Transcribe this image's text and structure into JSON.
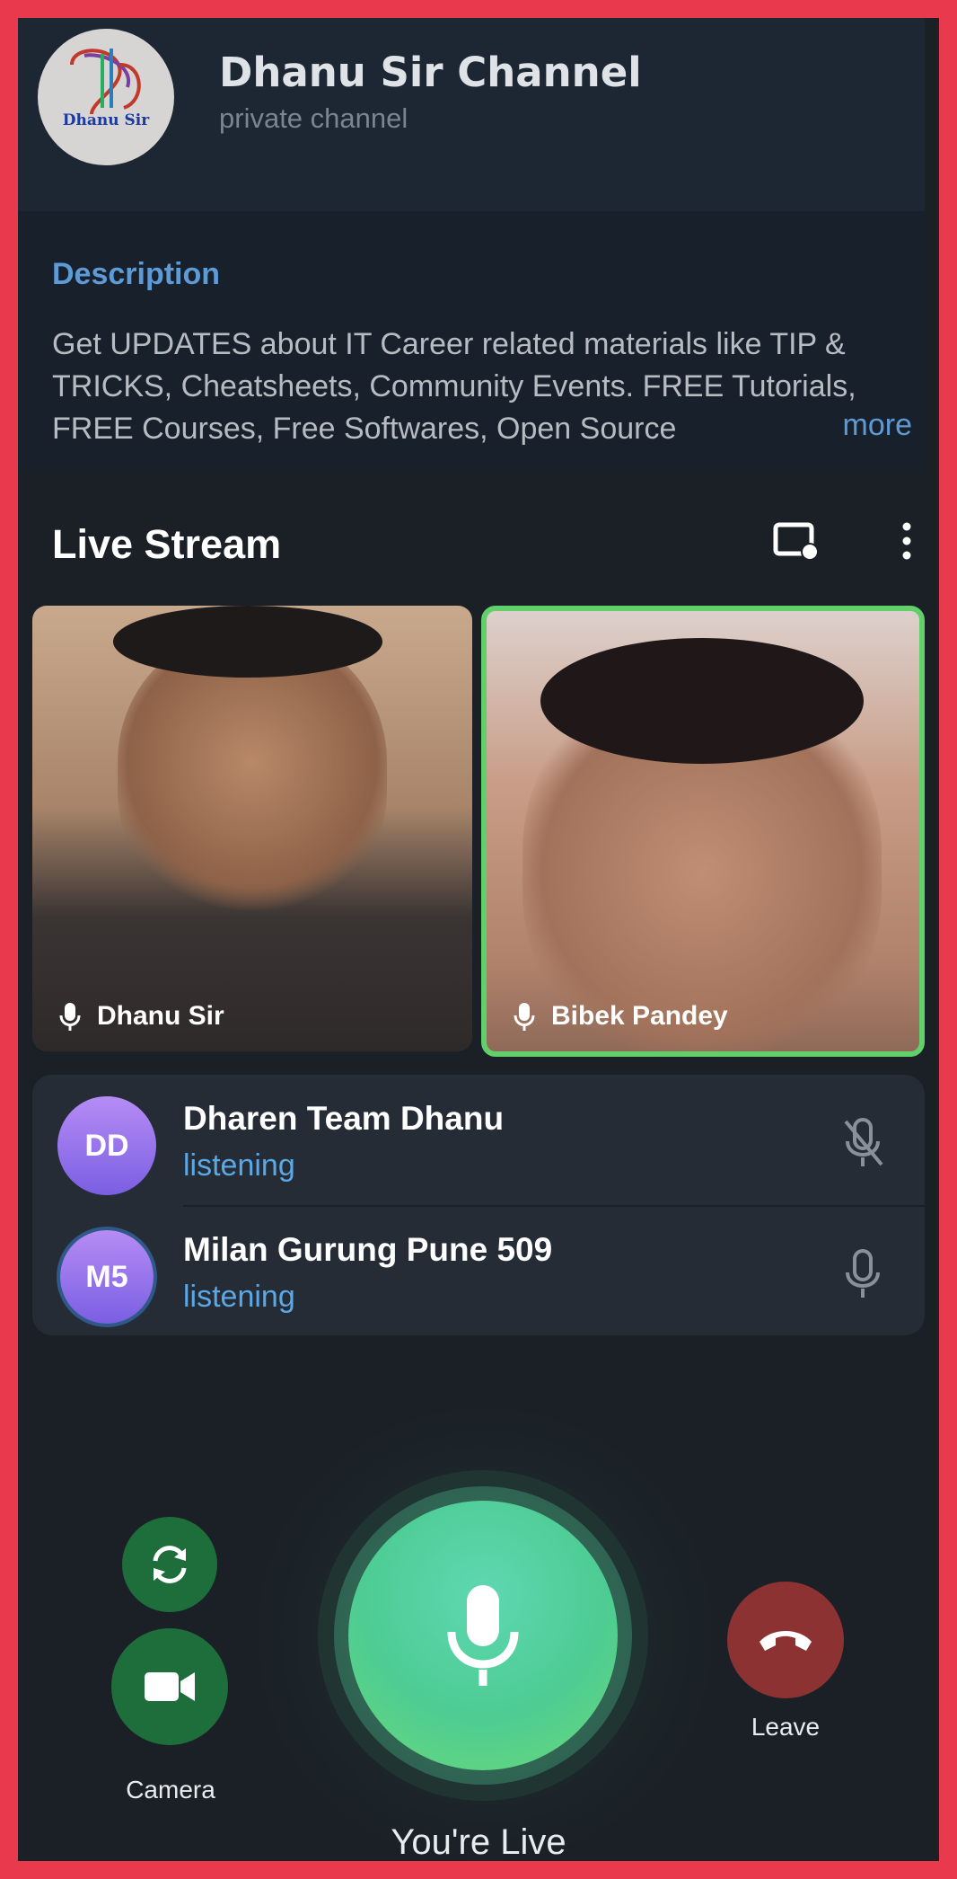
{
  "channel": {
    "title": "Dhanu Sir Channel",
    "subtitle": "private channel",
    "logo_text": "Dhanu Sir"
  },
  "description": {
    "label": "Description",
    "text": "Get UPDATES about IT Career related materials like TIP & TRICKS, Cheatsheets, Community Events. FREE Tutorials, FREE Courses, Free Softwares, Open Source",
    "more_label": "more"
  },
  "live_stream": {
    "title": "Live Stream"
  },
  "video_tiles": [
    {
      "name": "Dhanu Sir",
      "active_speaker": false
    },
    {
      "name": "Bibek Pandey",
      "active_speaker": true
    }
  ],
  "participants": [
    {
      "initials": "DD",
      "name": "Dharen Team Dhanu",
      "status": "listening",
      "mic": "muted"
    },
    {
      "initials": "M5",
      "name": "Milan Gurung Pune 509",
      "status": "listening",
      "mic": "on"
    }
  ],
  "controls": {
    "camera_label": "Camera",
    "leave_label": "Leave",
    "live_label": "You're Live"
  },
  "colors": {
    "accent": "#5e9bd6",
    "speaker_border": "#62d06a",
    "mic_button": "#4dcc93",
    "leave": "#8c3232",
    "border_frame": "#e8394d"
  }
}
